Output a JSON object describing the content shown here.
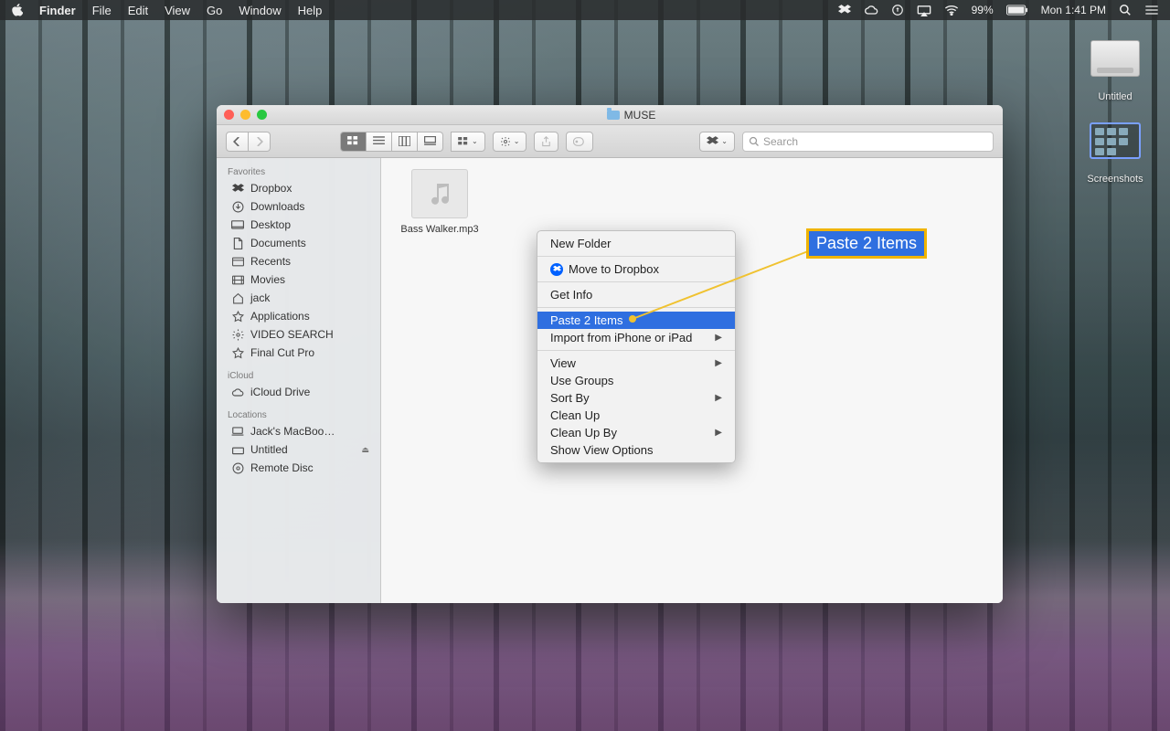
{
  "menubar": {
    "app": "Finder",
    "items": [
      "File",
      "Edit",
      "View",
      "Go",
      "Window",
      "Help"
    ],
    "battery": "99%",
    "clock": "Mon 1:41 PM"
  },
  "desktop": {
    "drive": "Untitled",
    "screenshots": "Screenshots"
  },
  "finder": {
    "title": "MUSE",
    "search_placeholder": "Search",
    "sidebar": {
      "favorites_label": "Favorites",
      "favorites": [
        "Dropbox",
        "Downloads",
        "Desktop",
        "Documents",
        "Recents",
        "Movies",
        "jack",
        "Applications",
        "VIDEO SEARCH",
        "Final Cut Pro"
      ],
      "icloud_label": "iCloud",
      "icloud": [
        "iCloud Drive"
      ],
      "locations_label": "Locations",
      "locations": [
        "Jack's MacBoo…",
        "Untitled",
        "Remote Disc"
      ]
    },
    "file": "Bass Walker.mp3"
  },
  "context_menu": {
    "new_folder": "New Folder",
    "move_dropbox": "Move to Dropbox",
    "get_info": "Get Info",
    "paste": "Paste 2 Items",
    "import": "Import from iPhone or iPad",
    "view": "View",
    "use_groups": "Use Groups",
    "sort_by": "Sort By",
    "clean_up": "Clean Up",
    "clean_up_by": "Clean Up By",
    "show_view_options": "Show View Options"
  },
  "callout": "Paste 2 Items"
}
